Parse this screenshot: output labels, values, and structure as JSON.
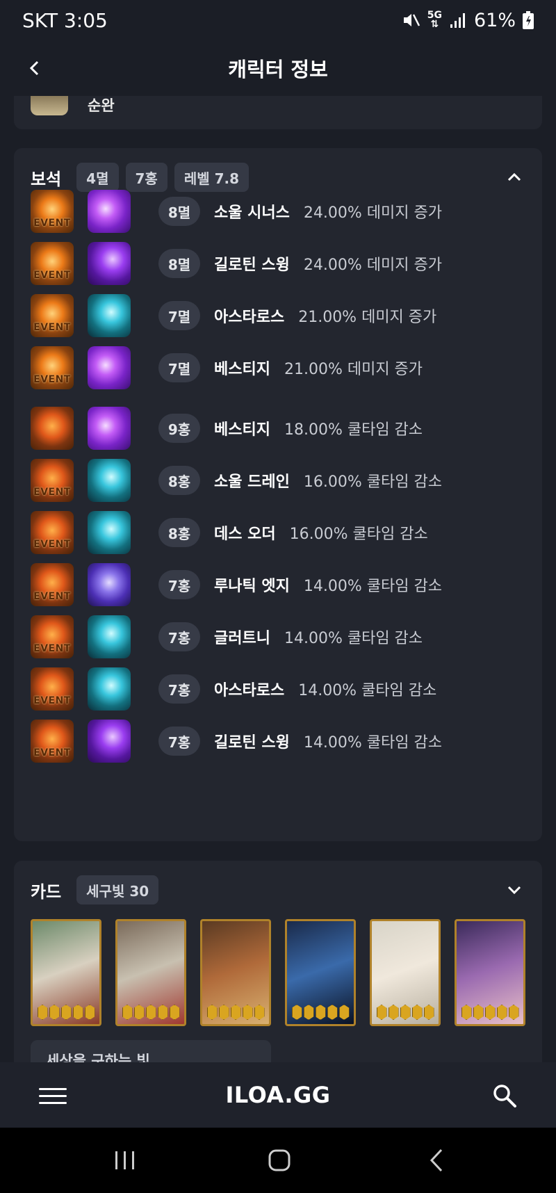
{
  "status_bar": {
    "carrier_time": "SKT 3:05",
    "network": "5G",
    "battery": "61%",
    "icons": [
      "mute-icon",
      "network-5g-icon",
      "signal-icon",
      "battery-icon"
    ]
  },
  "header": {
    "title": "캐릭터 정보",
    "back_icon": "chevron-left-icon"
  },
  "previous_section": {
    "partial_text": "순완"
  },
  "gems": {
    "title": "보석",
    "chips": [
      "4멸",
      "7홍",
      "레벨 7.8"
    ],
    "collapse_icon": "chevron-up-icon",
    "rows": [
      {
        "gem_type": "event",
        "gem_label": "EVENT",
        "skill_icon": "purple",
        "level": "8멸",
        "skill": "소울 시너스",
        "effect": "24.00% 데미지 증가"
      },
      {
        "gem_type": "event",
        "gem_label": "EVENT",
        "skill_icon": "violet",
        "level": "8멸",
        "skill": "길로틴 스윙",
        "effect": "24.00% 데미지 증가"
      },
      {
        "gem_type": "event",
        "gem_label": "EVENT",
        "skill_icon": "cyan",
        "level": "7멸",
        "skill": "아스타로스",
        "effect": "21.00% 데미지 증가"
      },
      {
        "gem_type": "event",
        "gem_label": "EVENT",
        "skill_icon": "purple",
        "level": "7멸",
        "skill": "베스티지",
        "effect": "21.00% 데미지 증가"
      },
      {
        "gem_type": "fire",
        "gem_label": "",
        "skill_icon": "purple",
        "level": "9홍",
        "skill": "베스티지",
        "effect": "18.00% 쿨타임 감소"
      },
      {
        "gem_type": "fire",
        "gem_label": "EVENT",
        "skill_icon": "cyan",
        "level": "8홍",
        "skill": "소울 드레인",
        "effect": "16.00% 쿨타임 감소"
      },
      {
        "gem_type": "fire",
        "gem_label": "EVENT",
        "skill_icon": "cyan",
        "level": "8홍",
        "skill": "데스 오더",
        "effect": "16.00% 쿨타임 감소"
      },
      {
        "gem_type": "fire",
        "gem_label": "EVENT",
        "skill_icon": "blue",
        "level": "7홍",
        "skill": "루나틱 엣지",
        "effect": "14.00% 쿨타임 감소"
      },
      {
        "gem_type": "fire",
        "gem_label": "EVENT",
        "skill_icon": "cyan",
        "level": "7홍",
        "skill": "글러트니",
        "effect": "14.00% 쿨타임 감소"
      },
      {
        "gem_type": "fire",
        "gem_label": "EVENT",
        "skill_icon": "cyan",
        "level": "7홍",
        "skill": "아스타로스",
        "effect": "14.00% 쿨타임 감소"
      },
      {
        "gem_type": "fire",
        "gem_label": "EVENT",
        "skill_icon": "violet",
        "level": "7홍",
        "skill": "길로틴 스윙",
        "effect": "14.00% 쿨타임 감소"
      }
    ]
  },
  "cards": {
    "title": "카드",
    "chip": "세구빛 30",
    "expand_icon": "chevron-down-icon",
    "items": [
      {
        "palette": [
          "#6c8a6a",
          "#d8d0c0",
          "#8a3a28"
        ],
        "awakening": 5
      },
      {
        "palette": [
          "#7a6a5a",
          "#c8c0b0",
          "#a03830"
        ],
        "awakening": 5
      },
      {
        "palette": [
          "#5a3a22",
          "#b06a3a",
          "#d8b070"
        ],
        "awakening": 5
      },
      {
        "palette": [
          "#1a2a4a",
          "#3a6aaa",
          "#0a1224"
        ],
        "awakening": 5
      },
      {
        "palette": [
          "#d8d4c8",
          "#f0e8dc",
          "#b8b0a0"
        ],
        "awakening": 5
      },
      {
        "palette": [
          "#3a2a5a",
          "#9a6ab0",
          "#e8c0c8"
        ],
        "awakening": 5
      }
    ],
    "set_name_partial": "세상을 구하는 빛"
  },
  "bottom_nav": {
    "logo": "ILOA.GG",
    "menu_icon": "hamburger-menu-icon",
    "search_icon": "search-icon"
  },
  "system_nav": {
    "icons": [
      "recent-apps-icon",
      "home-icon",
      "back-icon"
    ]
  }
}
